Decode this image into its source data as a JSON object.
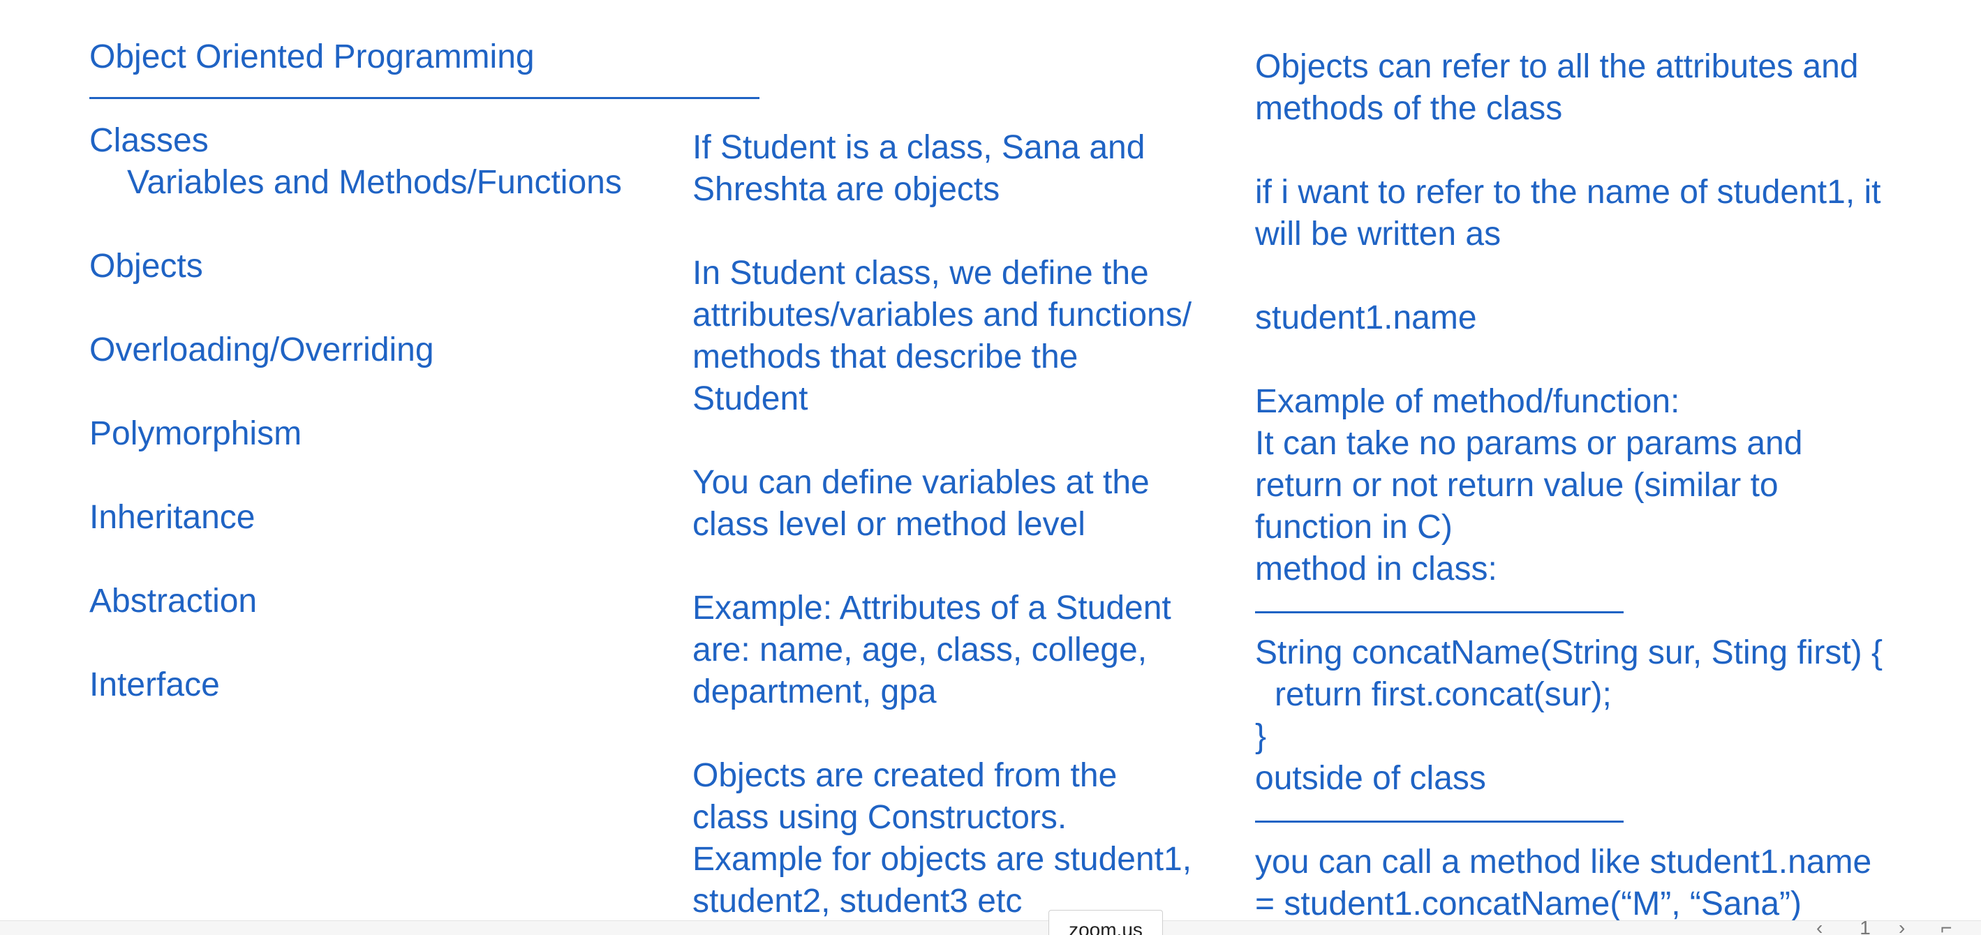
{
  "left": {
    "title": "Object Oriented Programming",
    "items": {
      "classes": "Classes",
      "classes_sub": "Variables and Methods/Functions",
      "objects": "Objects",
      "overloading": "Overloading/Overriding",
      "polymorphism": "Polymorphism",
      "inheritance": "Inheritance",
      "abstraction": "Abstraction",
      "interface": "Interface"
    }
  },
  "middle": {
    "lines": [
      "If Student is a class, Sana and",
      "Shreshta are objects",
      "In Student class, we define the",
      "attributes/variables and functions/",
      "methods that describe the",
      "Student",
      "You can define variables at the",
      "class level or method level",
      "Example: Attributes of a Student",
      "are:  name, age, class, college,",
      "department, gpa",
      "Objects are created from the",
      "class using Constructors.",
      "Example for objects are student1,",
      "student2, student3 etc"
    ]
  },
  "right": {
    "lines": [
      "Objects can refer to all the attributes and",
      "methods of the class",
      "if i want to refer to the name of student1, it",
      "will be written as",
      "student1.name",
      "Example of method/function:",
      "It can take no params or params and",
      "return or not return value (similar to",
      "function in C)",
      "method in class:",
      "String concatName(String sur, Sting first) {",
      "  return first.concat(sur);",
      "}",
      "outside of class",
      "you can call a method like student1.name",
      "= student1.concatName(“M”, “Sana”)"
    ]
  },
  "footer": {
    "zoom_label": "zoom.us",
    "prev": "‹",
    "page": "1",
    "next": "›",
    "corner": "⌐"
  }
}
